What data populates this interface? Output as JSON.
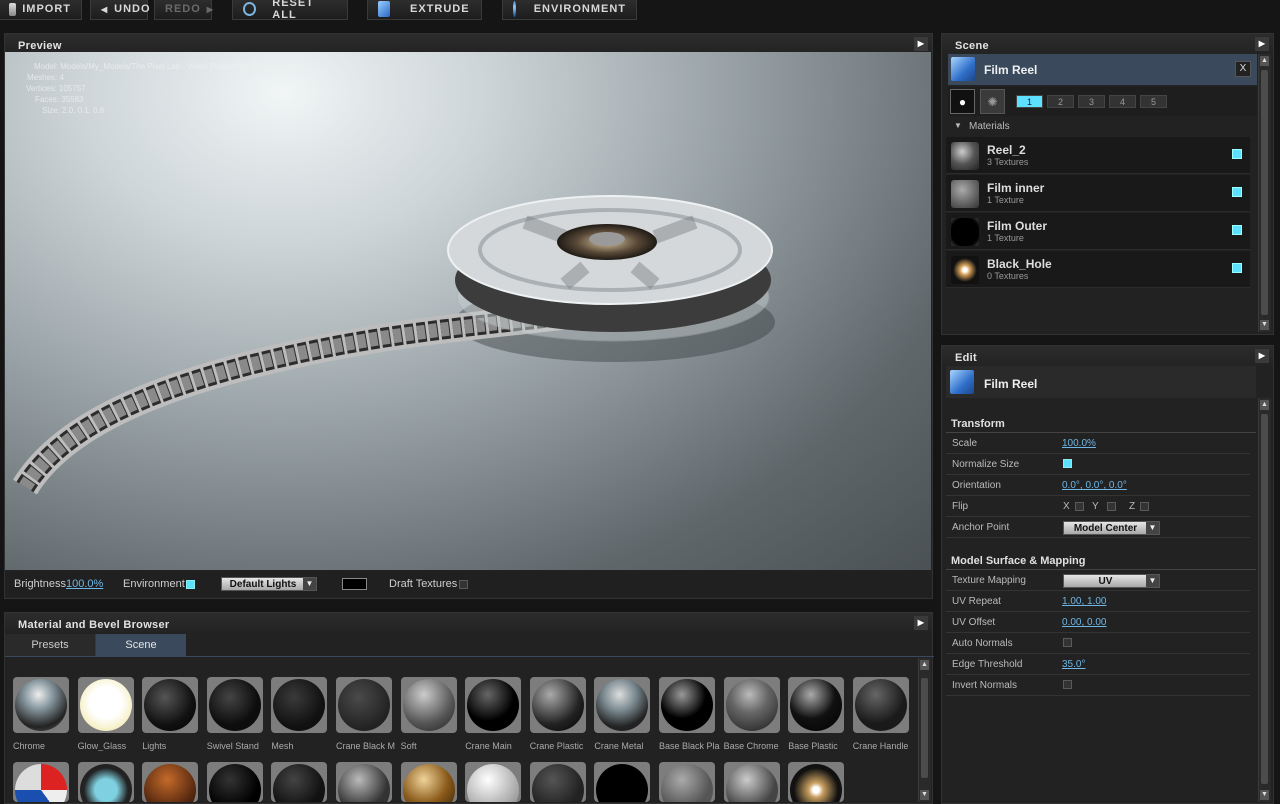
{
  "toolbar": {
    "import_label": "IMPORT",
    "undo_label": "UNDO",
    "redo_label": "REDO",
    "reset_label": "RESET ALL",
    "extrude_label": "EXTRUDE",
    "environment_label": "ENVIRONMENT"
  },
  "preview": {
    "title": "Preview",
    "info": {
      "model": "Model: Models/My_Models/The Pixel Lab - Video Production Pack/Film Reel",
      "meshes": "Meshes: 4",
      "vertices": "Vertices: 105757",
      "faces": "Faces: 35583",
      "size": "Size: 2.0, 0.1, 0.6"
    },
    "brightness_label": "Brightness",
    "brightness_value": "100.0%",
    "environment_label": "Environment",
    "lights_value": "Default Lights",
    "draft_label": "Draft Textures"
  },
  "scene": {
    "title": "Scene",
    "object_name": "Film Reel",
    "close_label": "X",
    "layers": [
      "1",
      "2",
      "3",
      "4",
      "5"
    ],
    "materials_label": "Materials",
    "materials": [
      {
        "name": "Reel_2",
        "sub": "3 Textures"
      },
      {
        "name": "Film inner",
        "sub": "1 Texture"
      },
      {
        "name": "Film Outer",
        "sub": "1 Texture"
      },
      {
        "name": "Black_Hole",
        "sub": "0 Textures"
      }
    ]
  },
  "edit": {
    "title": "Edit",
    "object_name": "Film Reel",
    "transform_label": "Transform",
    "scale_label": "Scale",
    "scale_value": "100.0%",
    "normalize_label": "Normalize Size",
    "orientation_label": "Orientation",
    "orientation_value": "0.0°, 0.0°, 0.0°",
    "flip_label": "Flip",
    "flip_x": "X",
    "flip_y": "Y",
    "flip_z": "Z",
    "anchor_label": "Anchor Point",
    "anchor_value": "Model Center",
    "surface_label": "Model Surface & Mapping",
    "texmap_label": "Texture Mapping",
    "texmap_value": "UV",
    "uvrepeat_label": "UV Repeat",
    "uvrepeat_value": "1.00, 1.00",
    "uvoffset_label": "UV Offset",
    "uvoffset_value": "0.00, 0.00",
    "autonormals_label": "Auto Normals",
    "edge_label": "Edge Threshold",
    "edge_value": "35.0°",
    "invert_label": "Invert Normals"
  },
  "browser": {
    "title": "Material and Bevel Browser",
    "tabs": [
      "Presets",
      "Scene"
    ],
    "active_tab": "Scene",
    "row1": [
      "Chrome",
      "Glow_Glass",
      "Lights",
      "Swivel Stand",
      "Mesh",
      "Crane Black M",
      "Soft",
      "Crane Main",
      "Crane Plastic",
      "Crane Metal",
      "Base Black Pla",
      "Base Chrome",
      "Base Plastic",
      "Crane Handle"
    ]
  },
  "colors": {
    "accent": "#5ee0ff",
    "link": "#6fb6e6",
    "selected_row": "#3a4a5c"
  }
}
